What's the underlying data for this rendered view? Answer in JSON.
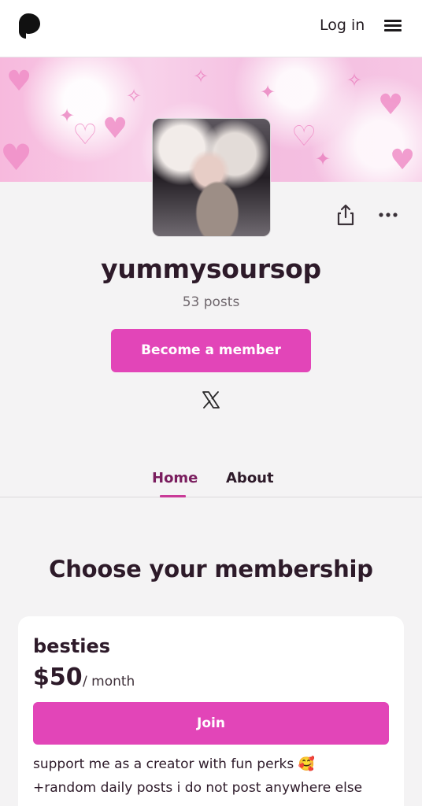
{
  "header": {
    "login_label": "Log in",
    "logo_icon": "patreon-logo-icon",
    "menu_icon": "hamburger-menu-icon"
  },
  "creator": {
    "name": "yummysoursop",
    "post_count": "53 posts",
    "become_member_label": "Become a member",
    "social_icon": "x-twitter-icon"
  },
  "actions": {
    "share_icon": "share-icon",
    "more_icon": "more-options-icon"
  },
  "tabs": [
    {
      "label": "Home",
      "active": true
    },
    {
      "label": "About",
      "active": false
    }
  ],
  "membership": {
    "title": "Choose your membership",
    "tier": {
      "name": "besties",
      "price": "$50",
      "period": "/ month",
      "join_label": "Join",
      "description_line1": "support me as a creator with fun perks 🥰",
      "description_line2": "+random daily posts i do not post anywhere else"
    }
  },
  "colors": {
    "accent": "#e245b8",
    "active_tab": "#7a1d5e",
    "text_primary": "#2d1a29",
    "background": "#f4f3f4"
  }
}
